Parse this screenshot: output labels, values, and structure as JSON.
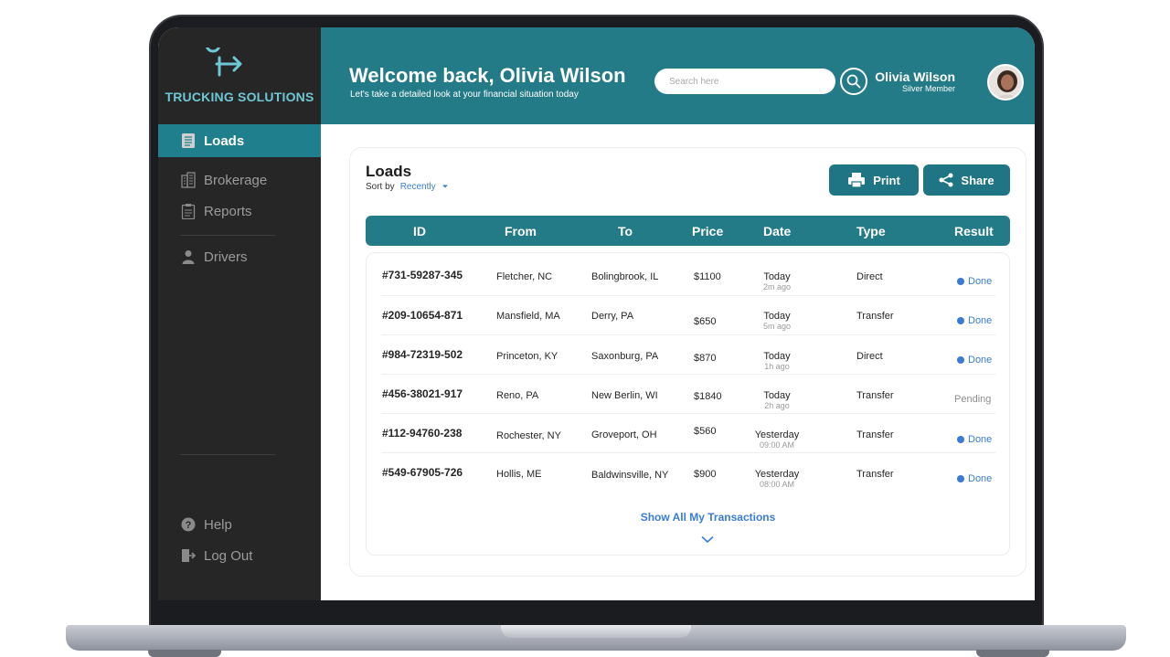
{
  "brand": {
    "name": "TRUCKING SOLUTIONS"
  },
  "sidebar": {
    "items": [
      {
        "label": "Loads",
        "icon": "document-icon",
        "active": true
      },
      {
        "label": "Brokerage",
        "icon": "building-icon"
      },
      {
        "label": "Reports",
        "icon": "clipboard-icon"
      },
      {
        "label": "Drivers",
        "icon": "user-icon"
      }
    ],
    "bottom": [
      {
        "label": "Help",
        "icon": "help-icon"
      },
      {
        "label": "Log Out",
        "icon": "logout-icon"
      }
    ]
  },
  "header": {
    "welcome": "Welcome back, Olivia Wilson",
    "subtitle": "Let's take a detailed look at your financial situation today",
    "search_placeholder": "Search here",
    "user_name": "Olivia Wilson",
    "user_role": "Silver Member"
  },
  "loads": {
    "title": "Loads",
    "sort_label": "Sort by",
    "sort_value": "Recently",
    "print_label": "Print",
    "share_label": "Share",
    "columns": [
      "ID",
      "From",
      "To",
      "Price",
      "Date",
      "Type",
      "Result"
    ],
    "rows": [
      {
        "id": "#731-59287-345",
        "from": "Fletcher, NC",
        "to": "Bolingbrook, IL",
        "price": "$1100",
        "date": "Today",
        "time": "2m ago",
        "type": "Direct",
        "result": "Done"
      },
      {
        "id": "#209-10654-871",
        "from": "Mansfield, MA",
        "to": "Derry, PA",
        "price": "$650",
        "date": "Today",
        "time": "5m ago",
        "type": "Transfer",
        "result": "Done"
      },
      {
        "id": "#984-72319-502",
        "from": "Princeton, KY",
        "to": "Saxonburg, PA",
        "price": "$870",
        "date": "Today",
        "time": "1h ago",
        "type": "Direct",
        "result": "Done"
      },
      {
        "id": "#456-38021-917",
        "from": "Reno, PA",
        "to": "New Berlin, WI",
        "price": "$1840",
        "date": "Today",
        "time": "2h ago",
        "type": "Transfer",
        "result": "Pending"
      },
      {
        "id": "#112-94760-238",
        "from": "Rochester, NY",
        "to": "Groveport, OH",
        "price": "$560",
        "date": "Yesterday",
        "time": "09:00 AM",
        "type": "Transfer",
        "result": "Done"
      },
      {
        "id": "#549-67905-726",
        "from": "Hollis, ME",
        "to": "Baldwinsville, NY",
        "price": "$900",
        "date": "Yesterday",
        "time": "08:00 AM",
        "type": "Transfer",
        "result": "Done"
      }
    ],
    "show_all": "Show All My Transactions"
  },
  "colors": {
    "teal": "#237b87",
    "sidebar": "#262626",
    "accent_blue": "#3a7bd5",
    "brand_text": "#6ec7d4"
  }
}
